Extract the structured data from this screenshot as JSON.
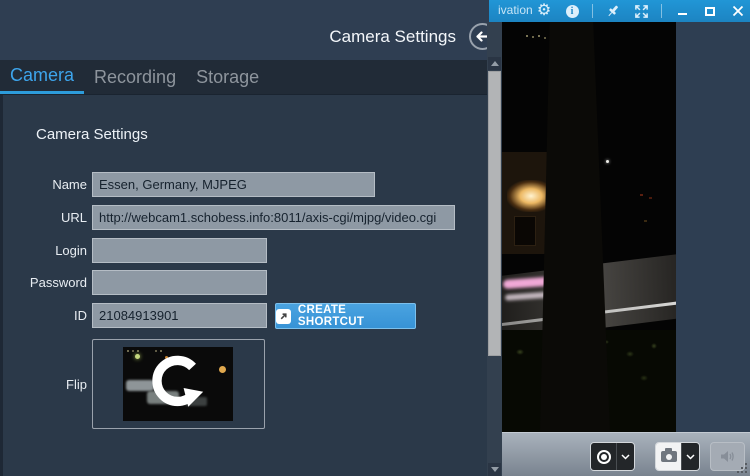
{
  "app_window": {
    "titlebar": {
      "partial_label": "ivation"
    }
  },
  "settings_panel": {
    "title": "Camera Settings",
    "tabs": [
      {
        "label": "Camera",
        "active": true
      },
      {
        "label": "Recording",
        "active": false
      },
      {
        "label": "Storage",
        "active": false
      }
    ],
    "section_heading": "Camera Settings",
    "form": {
      "name": {
        "label": "Name",
        "value": "Essen, Germany, MJPEG"
      },
      "url": {
        "label": "URL",
        "value": "http://webcam1.schobess.info:8011/axis-cgi/mjpg/video.cgi"
      },
      "login": {
        "label": "Login",
        "value": ""
      },
      "password": {
        "label": "Password",
        "value": ""
      },
      "id": {
        "label": "ID",
        "value": "21084913901"
      },
      "flip": {
        "label": "Flip"
      }
    },
    "buttons": {
      "create_shortcut": "CREATE SHORTCUT"
    }
  },
  "colors": {
    "titlebar_blue": "#1D87C6",
    "panel_bg": "#2B3949",
    "header_bg": "#2F3E52",
    "tabbar_bg": "#212B37",
    "active_tab_blue": "#3DA5EC",
    "field_bg": "#8E99A4",
    "accent_button_blue": "#3D9BDC"
  }
}
